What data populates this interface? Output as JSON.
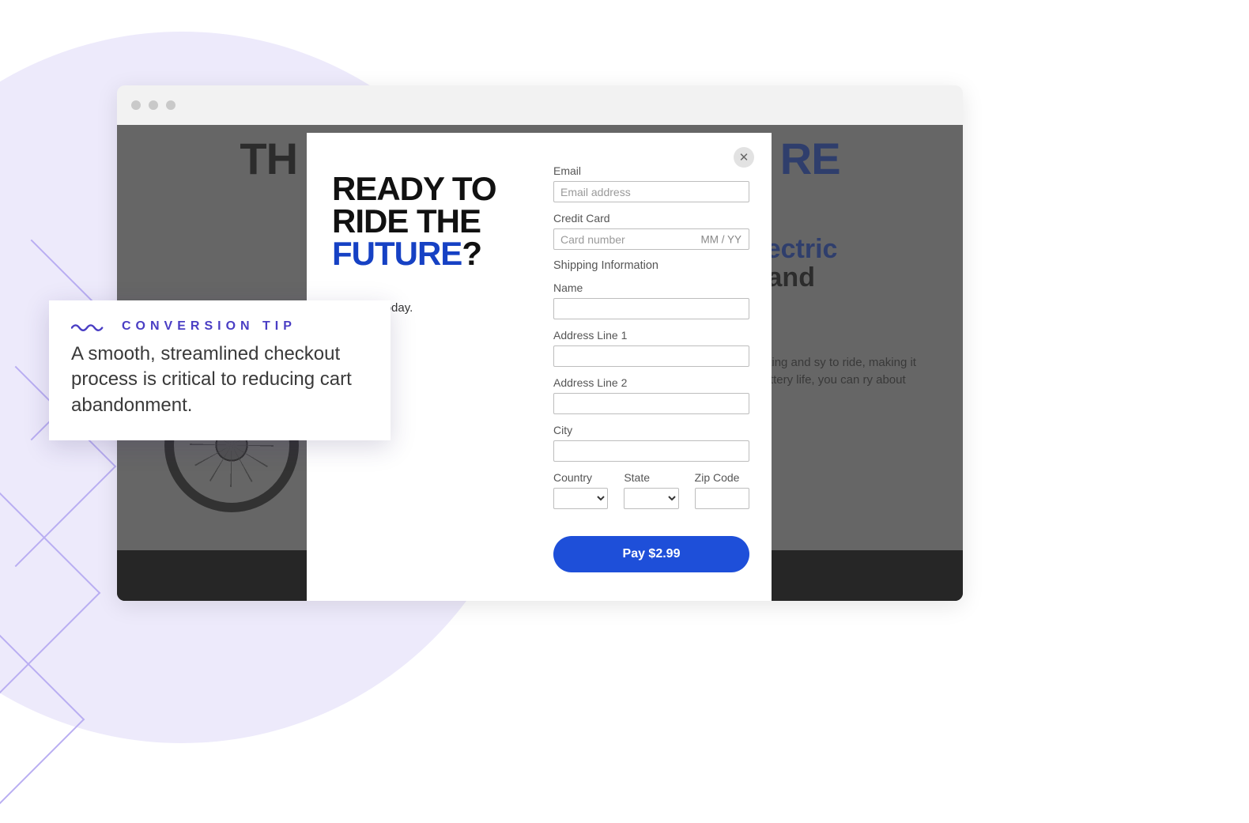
{
  "background": {
    "title_pre": "TH",
    "title_post": "RE",
    "subhead_line1": "est Electric",
    "subhead_line2": "uting and",
    "paragraph": "ike for commuting and sy to ride, making it perfect ong battery life, you can ry about running out of"
  },
  "modal": {
    "headline_l1": "READY TO",
    "headline_l2": "RIDE THE",
    "headline_l3": "FUTURE",
    "headline_q": "?",
    "subtext": "ur eBIKe today.",
    "email_label": "Email",
    "email_placeholder": "Email address",
    "card_label": "Credit Card",
    "card_placeholder": "Card number",
    "card_expiry_hint": "MM / YY",
    "ship_label": "Shipping Information",
    "name_label": "Name",
    "addr1_label": "Address Line 1",
    "addr2_label": "Address Line 2",
    "city_label": "City",
    "country_label": "Country",
    "state_label": "State",
    "zip_label": "Zip Code",
    "pay_label": "Pay $2.99"
  },
  "tip": {
    "label": "CONVERSION TIP",
    "body": "A smooth, streamlined checkout process is critical to reducing cart abandonment."
  }
}
